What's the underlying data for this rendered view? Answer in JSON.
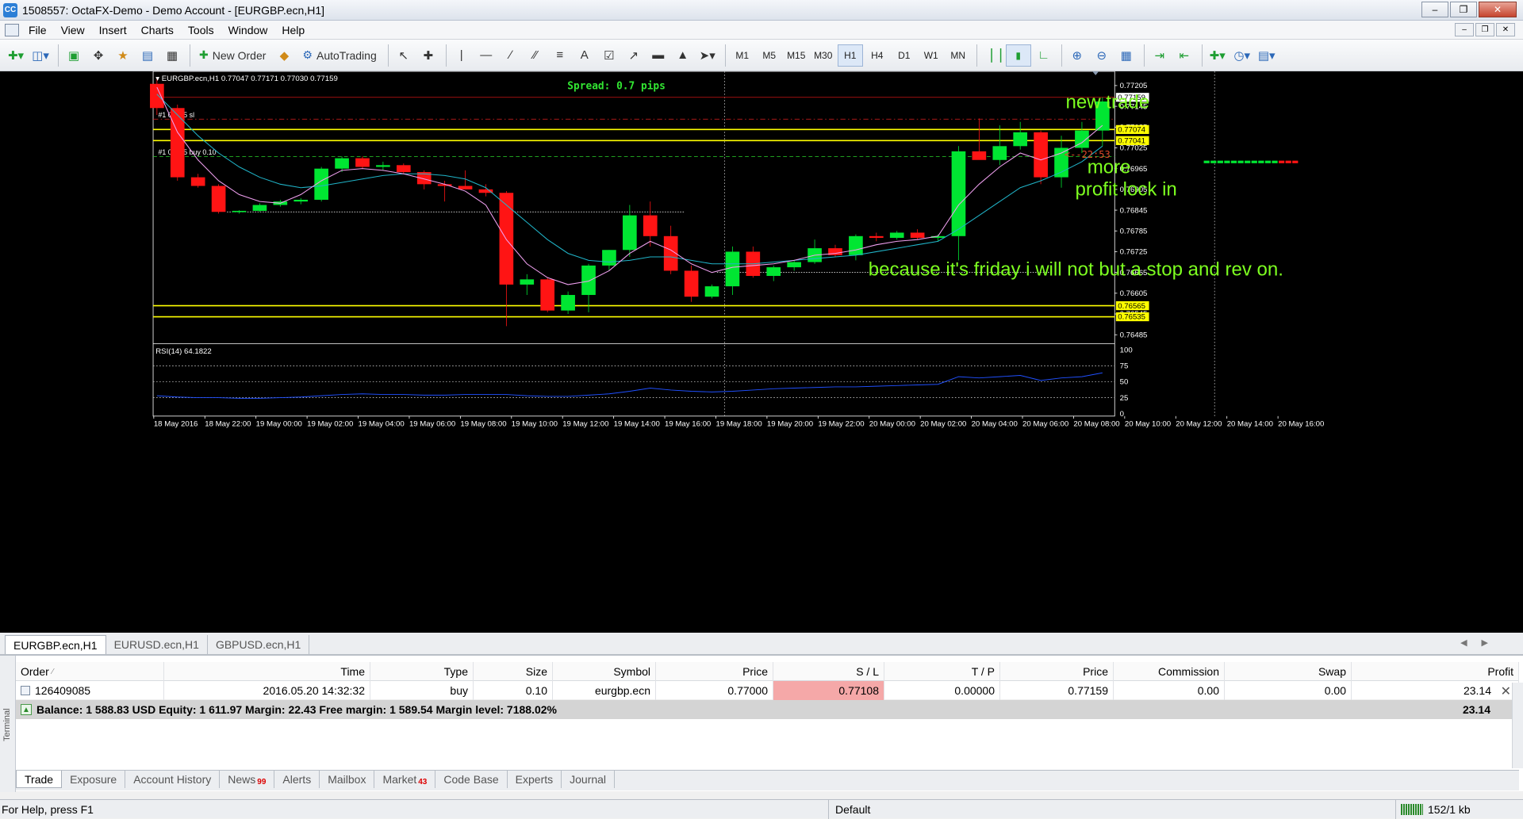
{
  "window": {
    "title": "1508557: OctaFX-Demo - Demo Account - [EURGBP.ecn,H1]",
    "app_icon": "mt4-icon"
  },
  "menu": [
    "File",
    "View",
    "Insert",
    "Charts",
    "Tools",
    "Window",
    "Help"
  ],
  "toolbar": {
    "new_order": "New Order",
    "autotrading": "AutoTrading",
    "timeframes": [
      "M1",
      "M5",
      "M15",
      "M30",
      "H1",
      "H4",
      "D1",
      "W1",
      "MN"
    ],
    "active_timeframe": "H1",
    "text_tool": "A"
  },
  "chart": {
    "header": "EURGBP.ecn,H1  0.77047 0.77171 0.77030 0.77159",
    "spread": "Spread: 0.7 pips",
    "sl_label": "#1  09085 sl",
    "buy_label": "#1  09085 buy 0.10",
    "countdown": "<--22:53",
    "annotations": {
      "new_trade": "new trade",
      "more": "more",
      "profit_lock": "profit lock in",
      "friday_note": "because it's friday i will not but a stop and rev on."
    },
    "price_ticks": [
      "0.77205",
      "0.77145",
      "0.77085",
      "0.77025",
      "0.76965",
      "0.76905",
      "0.76845",
      "0.76785",
      "0.76725",
      "0.76665",
      "0.76605",
      "0.76545",
      "0.76485"
    ],
    "price_labels": {
      "current": "0.77159",
      "line_a": "0.77074",
      "line_b": "0.77041",
      "line_c": "0.76565",
      "line_d": "0.76535"
    },
    "rsi_header": "RSI(14) 64.1822",
    "rsi_ticks": [
      "100",
      "75",
      "50",
      "25",
      "0"
    ],
    "time_ticks": [
      "18 May 2016",
      "18 May 22:00",
      "19 May 00:00",
      "19 May 02:00",
      "19 May 04:00",
      "19 May 06:00",
      "19 May 08:00",
      "19 May 10:00",
      "19 May 12:00",
      "19 May 14:00",
      "19 May 16:00",
      "19 May 18:00",
      "19 May 20:00",
      "19 May 22:00",
      "20 May 00:00",
      "20 May 02:00",
      "20 May 04:00",
      "20 May 06:00",
      "20 May 08:00",
      "20 May 10:00",
      "20 May 12:00",
      "20 May 14:00",
      "20 May 16:00"
    ],
    "colors": {
      "bull": "#00e632",
      "bear": "#ff1414",
      "level_line": "#ffff00",
      "ma_fast": "#f0a0f0",
      "ma_slow": "#20b4c8",
      "rsi": "#2050ff",
      "annotation": "#7dff20",
      "spread": "#32e632"
    },
    "candles": [
      {
        "o": 0.7721,
        "h": 0.77225,
        "l": 0.7712,
        "c": 0.7714
      },
      {
        "o": 0.7714,
        "h": 0.7715,
        "l": 0.7693,
        "c": 0.7694
      },
      {
        "o": 0.7694,
        "h": 0.7695,
        "l": 0.7691,
        "c": 0.76915
      },
      {
        "o": 0.76915,
        "h": 0.7692,
        "l": 0.76835,
        "c": 0.7684
      },
      {
        "o": 0.7684,
        "h": 0.76845,
        "l": 0.76835,
        "c": 0.76843
      },
      {
        "o": 0.76843,
        "h": 0.76865,
        "l": 0.7684,
        "c": 0.7686
      },
      {
        "o": 0.7686,
        "h": 0.76875,
        "l": 0.76855,
        "c": 0.7687
      },
      {
        "o": 0.7687,
        "h": 0.7688,
        "l": 0.76862,
        "c": 0.76875
      },
      {
        "o": 0.76875,
        "h": 0.7697,
        "l": 0.7687,
        "c": 0.76965
      },
      {
        "o": 0.76965,
        "h": 0.77,
        "l": 0.76955,
        "c": 0.76995
      },
      {
        "o": 0.76995,
        "h": 0.77,
        "l": 0.76965,
        "c": 0.7697
      },
      {
        "o": 0.7697,
        "h": 0.76985,
        "l": 0.7696,
        "c": 0.76975
      },
      {
        "o": 0.76975,
        "h": 0.7698,
        "l": 0.7695,
        "c": 0.76955
      },
      {
        "o": 0.76955,
        "h": 0.7696,
        "l": 0.76905,
        "c": 0.7692
      },
      {
        "o": 0.7692,
        "h": 0.7693,
        "l": 0.7687,
        "c": 0.76915
      },
      {
        "o": 0.76915,
        "h": 0.7696,
        "l": 0.76905,
        "c": 0.76905
      },
      {
        "o": 0.76905,
        "h": 0.7692,
        "l": 0.76885,
        "c": 0.76895
      },
      {
        "o": 0.76895,
        "h": 0.769,
        "l": 0.7651,
        "c": 0.7663
      },
      {
        "o": 0.7663,
        "h": 0.7666,
        "l": 0.766,
        "c": 0.76645
      },
      {
        "o": 0.76645,
        "h": 0.7665,
        "l": 0.7655,
        "c": 0.76555
      },
      {
        "o": 0.76555,
        "h": 0.7661,
        "l": 0.76545,
        "c": 0.766
      },
      {
        "o": 0.766,
        "h": 0.7669,
        "l": 0.7655,
        "c": 0.76685
      },
      {
        "o": 0.76685,
        "h": 0.7673,
        "l": 0.7667,
        "c": 0.7673
      },
      {
        "o": 0.7673,
        "h": 0.7686,
        "l": 0.7671,
        "c": 0.7683
      },
      {
        "o": 0.7683,
        "h": 0.7687,
        "l": 0.7674,
        "c": 0.7677
      },
      {
        "o": 0.7677,
        "h": 0.768,
        "l": 0.7666,
        "c": 0.7667
      },
      {
        "o": 0.7667,
        "h": 0.76685,
        "l": 0.7658,
        "c": 0.76595
      },
      {
        "o": 0.76595,
        "h": 0.7663,
        "l": 0.7659,
        "c": 0.76625
      },
      {
        "o": 0.76625,
        "h": 0.7674,
        "l": 0.766,
        "c": 0.76725
      },
      {
        "o": 0.76725,
        "h": 0.7674,
        "l": 0.7665,
        "c": 0.76655
      },
      {
        "o": 0.76655,
        "h": 0.76685,
        "l": 0.7664,
        "c": 0.7668
      },
      {
        "o": 0.7668,
        "h": 0.767,
        "l": 0.7667,
        "c": 0.76695
      },
      {
        "o": 0.76695,
        "h": 0.7676,
        "l": 0.7669,
        "c": 0.76735
      },
      {
        "o": 0.76735,
        "h": 0.76745,
        "l": 0.7671,
        "c": 0.76715
      },
      {
        "o": 0.76715,
        "h": 0.76775,
        "l": 0.767,
        "c": 0.7677
      },
      {
        "o": 0.7677,
        "h": 0.7678,
        "l": 0.76755,
        "c": 0.76765
      },
      {
        "o": 0.76765,
        "h": 0.76785,
        "l": 0.7676,
        "c": 0.7678
      },
      {
        "o": 0.7678,
        "h": 0.7679,
        "l": 0.7676,
        "c": 0.76765
      },
      {
        "o": 0.76765,
        "h": 0.76775,
        "l": 0.76755,
        "c": 0.7677
      },
      {
        "o": 0.7677,
        "h": 0.7703,
        "l": 0.767,
        "c": 0.77015
      },
      {
        "o": 0.77015,
        "h": 0.7711,
        "l": 0.77,
        "c": 0.7699
      },
      {
        "o": 0.7699,
        "h": 0.7709,
        "l": 0.76975,
        "c": 0.7703
      },
      {
        "o": 0.7703,
        "h": 0.771,
        "l": 0.7702,
        "c": 0.7707
      },
      {
        "o": 0.7707,
        "h": 0.77075,
        "l": 0.7692,
        "c": 0.7694
      },
      {
        "o": 0.7694,
        "h": 0.7706,
        "l": 0.7691,
        "c": 0.77025
      },
      {
        "o": 0.77025,
        "h": 0.771,
        "l": 0.7701,
        "c": 0.77075
      },
      {
        "o": 0.77075,
        "h": 0.77171,
        "l": 0.7703,
        "c": 0.77159
      }
    ],
    "ma_fast": [
      0.772,
      0.7707,
      0.7699,
      0.7693,
      0.7689,
      0.7687,
      0.76865,
      0.7689,
      0.7693,
      0.7696,
      0.76965,
      0.7696,
      0.7695,
      0.76935,
      0.7692,
      0.769,
      0.7686,
      0.7676,
      0.7669,
      0.7665,
      0.7663,
      0.7664,
      0.7667,
      0.7672,
      0.76755,
      0.7673,
      0.7669,
      0.76665,
      0.7668,
      0.76685,
      0.7669,
      0.767,
      0.76715,
      0.7672,
      0.7673,
      0.76745,
      0.76755,
      0.7676,
      0.7677,
      0.7686,
      0.7692,
      0.7697,
      0.7701,
      0.7699,
      0.7701,
      0.7704,
      0.7709
    ],
    "ma_slow": [
      0.7718,
      0.7712,
      0.7706,
      0.7701,
      0.7697,
      0.7694,
      0.7692,
      0.7691,
      0.76915,
      0.76925,
      0.76935,
      0.76945,
      0.7695,
      0.7695,
      0.76945,
      0.76935,
      0.7691,
      0.7686,
      0.7681,
      0.7676,
      0.7672,
      0.767,
      0.76695,
      0.767,
      0.7671,
      0.7671,
      0.767,
      0.7669,
      0.7669,
      0.7669,
      0.76695,
      0.767,
      0.76705,
      0.7671,
      0.76715,
      0.76725,
      0.76735,
      0.76745,
      0.76755,
      0.7679,
      0.7683,
      0.7687,
      0.7691,
      0.7693,
      0.76955,
      0.76985,
      0.7703
    ],
    "rsi_values": [
      28,
      26,
      25,
      25,
      24,
      24,
      25,
      26,
      28,
      30,
      31,
      30,
      30,
      29,
      29,
      30,
      30,
      30,
      28,
      27,
      27,
      29,
      31,
      35,
      40,
      37,
      35,
      34,
      35,
      37,
      39,
      40,
      41,
      42,
      42,
      43,
      44,
      45,
      46,
      58,
      56,
      58,
      60,
      52,
      56,
      58,
      64
    ]
  },
  "symbol_tabs": [
    "EURGBP.ecn,H1",
    "EURUSD.ecn,H1",
    "GBPUSD.ecn,H1"
  ],
  "orders": {
    "columns": [
      "Order",
      "Time",
      "Type",
      "Size",
      "Symbol",
      "Price",
      "S / L",
      "T / P",
      "Price",
      "Commission",
      "Swap",
      "Profit"
    ],
    "rows": [
      {
        "order": "126409085",
        "time": "2016.05.20 14:32:32",
        "type": "buy",
        "size": "0.10",
        "symbol": "eurgbp.ecn",
        "price": "0.77000",
        "sl": "0.77108",
        "tp": "0.00000",
        "cur_price": "0.77159",
        "commission": "0.00",
        "swap": "0.00",
        "profit": "23.14"
      }
    ],
    "balance_line": "Balance: 1 588.83 USD  Equity: 1 611.97  Margin: 22.43  Free margin: 1 589.54  Margin level: 7188.02%",
    "balance_total": "23.14"
  },
  "terminal_tabs": [
    {
      "label": "Trade"
    },
    {
      "label": "Exposure"
    },
    {
      "label": "Account History"
    },
    {
      "label": "News",
      "badge": "99"
    },
    {
      "label": "Alerts"
    },
    {
      "label": "Mailbox"
    },
    {
      "label": "Market",
      "badge": "43"
    },
    {
      "label": "Code Base"
    },
    {
      "label": "Experts"
    },
    {
      "label": "Journal"
    }
  ],
  "terminal_side_label": "Terminal",
  "status": {
    "help": "For Help, press F1",
    "profile": "Default",
    "traffic": "152/1 kb"
  }
}
